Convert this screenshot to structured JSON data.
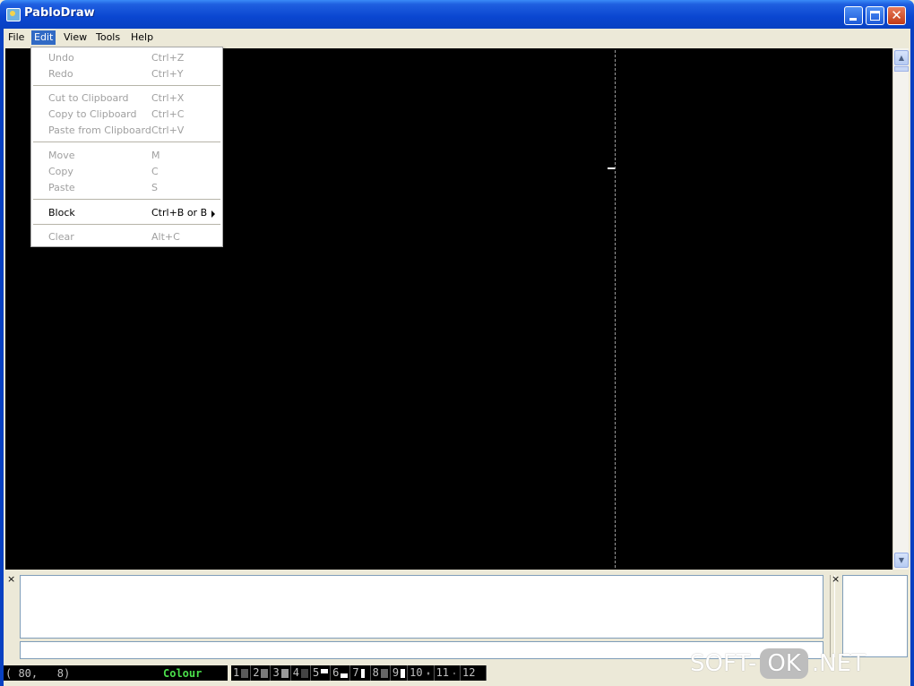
{
  "window": {
    "title": "PabloDraw",
    "app_icon": "pablodraw-app-icon"
  },
  "menubar": [
    {
      "label": "File",
      "active": false
    },
    {
      "label": "Edit",
      "active": true
    },
    {
      "label": "View",
      "active": false
    },
    {
      "label": "Tools",
      "active": false
    },
    {
      "label": "Help",
      "active": false
    }
  ],
  "edit_menu": {
    "items": [
      {
        "label": "Undo",
        "shortcut": "Ctrl+Z",
        "enabled": false
      },
      {
        "label": "Redo",
        "shortcut": "Ctrl+Y",
        "enabled": false
      },
      {
        "label": "Cut to Clipboard",
        "shortcut": "Ctrl+X",
        "enabled": false
      },
      {
        "label": "Copy to Clipboard",
        "shortcut": "Ctrl+C",
        "enabled": false
      },
      {
        "label": "Paste from Clipboard",
        "shortcut": "Ctrl+V",
        "enabled": false
      },
      {
        "label": "Move",
        "shortcut": "M",
        "enabled": false
      },
      {
        "label": "Copy",
        "shortcut": "C",
        "enabled": false
      },
      {
        "label": "Paste",
        "shortcut": "S",
        "enabled": false
      },
      {
        "label": "Block",
        "shortcut": "Ctrl+B or B",
        "enabled": true,
        "submenu": true
      },
      {
        "label": "Clear",
        "shortcut": "Alt+C",
        "enabled": false
      }
    ]
  },
  "panel": {
    "close_glyph": "×"
  },
  "status": {
    "coords": "( 80,   8)",
    "colour_label": "Colour",
    "fkeys": [
      "1",
      "2",
      "3",
      "4",
      "5",
      "6",
      "7",
      "8",
      "9",
      "10",
      "11",
      "12"
    ]
  },
  "watermark": {
    "left": "SOFT-",
    "middle": "OK",
    "right": ".NET"
  },
  "colors": {
    "accent": "#316ac5",
    "titlebar": "#0a46d0",
    "canvas": "#000000",
    "colour_text": "#4be04b"
  }
}
